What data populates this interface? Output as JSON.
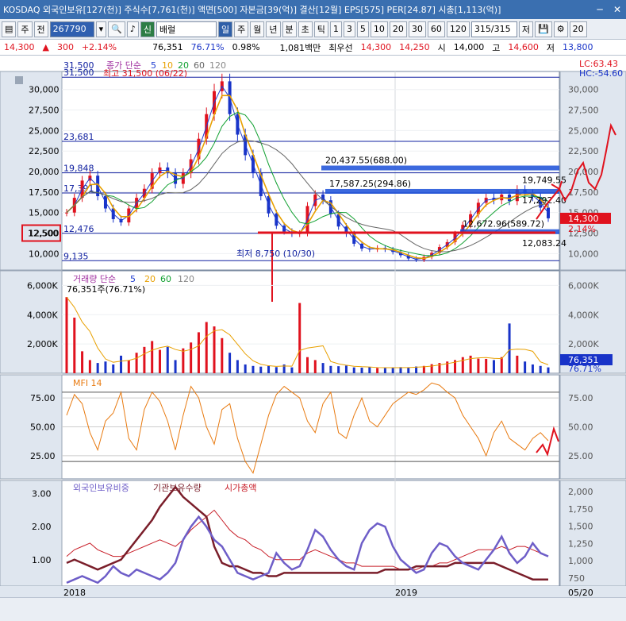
{
  "window": {
    "title": "KOSDAQ 외국인보유[127(천)] 주식수[7,761(천)] 액면[500] 자본금[39(억)] 결산[12월] EPS[575] PER[24.87] 시총[1,113(억)]",
    "minimize": "─",
    "close": "✕"
  },
  "toolbar": {
    "first_btn": "주",
    "second_btn": "전",
    "code": "267790",
    "name_tag": "신",
    "name": "배럴",
    "periods": [
      "일",
      "주",
      "월",
      "년",
      "분",
      "초",
      "틱"
    ],
    "intervals": [
      "1",
      "3",
      "5",
      "10",
      "20",
      "30",
      "60",
      "120"
    ],
    "count": "315/315",
    "buttons": [
      "저",
      "💾",
      "⚙"
    ],
    "extra": "20"
  },
  "quote": {
    "price": "14,300",
    "change_sign": "▲",
    "change": "300",
    "pct": "+2.14%",
    "volume": "76,351",
    "vol_ratio": "76.71%",
    "vol_pct": "0.98%",
    "amount": "1,081백만",
    "label_first": "최우선",
    "ask": "14,300",
    "bid": "14,250",
    "open_label": "시",
    "open": "14,000",
    "high_label": "고",
    "high": "14,600",
    "low_label": "저",
    "low": "13,800"
  },
  "price_panel": {
    "legend": {
      "name": "종가 단순",
      "p1": "5",
      "p2": "10",
      "p3": "20",
      "p4": "60",
      "p5": "120"
    },
    "lc": "LC:63.43",
    "hc": "HC:-54.60",
    "y_ticks": [
      "30,000",
      "27,500",
      "25,000",
      "22,500",
      "20,000",
      "17,500",
      "15,000",
      "12,500",
      "10,000"
    ],
    "y_values": [
      30000,
      27500,
      25000,
      22500,
      20000,
      17500,
      15000,
      12500,
      10000
    ],
    "hlines": [
      {
        "label": "31,500",
        "v": 31500
      },
      {
        "label": "23,681",
        "v": 23681
      },
      {
        "label": "19,848",
        "v": 19848
      },
      {
        "label": "17,391",
        "v": 17391
      },
      {
        "label": "12,476",
        "v": 12476
      },
      {
        "label": "9,135",
        "v": 9135
      }
    ],
    "top_label": "31,500",
    "max_note": "최고 31,500 (06/22)",
    "min_note": "최저 8,750 (10/30)",
    "boxes": [
      {
        "label": "20,437.55(688.00)",
        "v": 20437
      },
      {
        "label": "17,587.25(294.86)",
        "v": 17587
      },
      {
        "label": "12,672.96(589.72)",
        "v": 12673
      }
    ],
    "right_labels": [
      {
        "label": "19,749.55",
        "v": 19749
      },
      {
        "label": "17,292.40",
        "v": 17292
      },
      {
        "label": "12,083.24",
        "v": 12083
      }
    ],
    "current": "14,300",
    "current_pct": "2.14%",
    "left_marker": "12,500"
  },
  "volume_panel": {
    "legend": {
      "name": "거래량 단순",
      "p1": "5",
      "p2": "20",
      "p3": "60",
      "p4": "120"
    },
    "current": "76,351주(76.71%)",
    "y_ticks": [
      "6,000K",
      "4,000K",
      "2,000K"
    ],
    "right_val": "76,351",
    "right_pct": "76.71%"
  },
  "mfi_panel": {
    "legend": "MFI 14",
    "y_ticks": [
      "75.00",
      "50.00",
      "25.00"
    ]
  },
  "foreign_panel": {
    "legend": {
      "s1": "외국인보유비중",
      "s2": "기관보유수량",
      "s3": "시가총액"
    },
    "y_left": [
      "3.00",
      "2.00",
      "1.00"
    ],
    "y_right": [
      "2,000",
      "1,750",
      "1,500",
      "1,250",
      "1,000",
      "750"
    ]
  },
  "x_axis": {
    "labels": [
      "2018",
      "2019",
      "05/20"
    ]
  },
  "chart_data": {
    "type": "line",
    "title": "",
    "x": [
      "2018",
      "2019",
      "05/20"
    ],
    "price_close": [
      15000,
      16800,
      18900,
      19500,
      17000,
      15500,
      14200,
      13800,
      15500,
      16800,
      17900,
      19800,
      20500,
      19800,
      18500,
      19800,
      21500,
      24000,
      27000,
      29800,
      31000,
      27000,
      24500,
      22000,
      19800,
      17000,
      14900,
      13400,
      12700,
      12400,
      12476,
      15800,
      17200,
      16500,
      14800,
      13300,
      12400,
      11200,
      10600,
      10500,
      10700,
      10500,
      10200,
      9800,
      9400,
      9250,
      9600,
      10100,
      10800,
      11400,
      12400,
      13500,
      14800,
      16200,
      16800,
      16500,
      17200,
      16400,
      17800,
      17300,
      16900,
      15600,
      14300
    ],
    "ma_overlay": [
      "5",
      "10",
      "20",
      "60",
      "120"
    ],
    "volume_k_approx": [
      5200,
      3800,
      1500,
      900,
      700,
      800,
      600,
      1200,
      900,
      1400,
      1800,
      2200,
      1600,
      1800,
      900,
      1700,
      2100,
      2800,
      3500,
      3200,
      2400,
      1400,
      900,
      600,
      500,
      450,
      500,
      420,
      600,
      400,
      4800,
      1100,
      900,
      700,
      500,
      480,
      520,
      400,
      380,
      420,
      360,
      350,
      400,
      420,
      380,
      460,
      500,
      620,
      700,
      800,
      900,
      1100,
      1200,
      1000,
      980,
      900,
      1100,
      3400,
      1200,
      800,
      600,
      500,
      400
    ],
    "mfi": [
      60,
      78,
      70,
      45,
      30,
      55,
      62,
      80,
      40,
      30,
      65,
      80,
      72,
      55,
      30,
      60,
      85,
      75,
      50,
      35,
      65,
      70,
      40,
      20,
      10,
      35,
      60,
      78,
      85,
      80,
      75,
      55,
      45,
      70,
      80,
      45,
      40,
      60,
      75,
      55,
      50,
      60,
      70,
      75,
      80,
      78,
      82,
      88,
      86,
      80,
      75,
      60,
      50,
      40,
      25,
      45,
      55,
      40,
      35,
      30,
      40,
      45,
      38
    ],
    "foreign_pct": [
      0.3,
      0.4,
      0.5,
      0.4,
      0.3,
      0.5,
      0.8,
      0.6,
      0.5,
      0.7,
      0.6,
      0.5,
      0.4,
      0.6,
      0.9,
      1.6,
      2.0,
      2.3,
      2.0,
      1.6,
      1.4,
      1.0,
      0.6,
      0.5,
      0.4,
      0.5,
      0.6,
      1.2,
      0.9,
      0.7,
      0.8,
      1.3,
      1.9,
      1.7,
      1.3,
      1.0,
      0.8,
      0.7,
      1.5,
      1.9,
      2.1,
      2.0,
      1.4,
      1.0,
      0.8,
      0.6,
      0.7,
      1.2,
      1.5,
      1.4,
      1.1,
      0.9,
      0.8,
      0.7,
      1.0,
      1.3,
      1.7,
      1.2,
      0.9,
      1.1,
      1.5,
      1.2,
      1.1
    ],
    "institution_pct": [
      0.9,
      1.0,
      0.9,
      0.8,
      0.7,
      0.8,
      0.9,
      1.0,
      1.3,
      1.6,
      1.9,
      2.2,
      2.6,
      2.9,
      3.2,
      2.9,
      2.7,
      2.5,
      2.3,
      1.4,
      0.9,
      0.8,
      0.8,
      0.7,
      0.6,
      0.6,
      0.5,
      0.5,
      0.6,
      0.6,
      0.6,
      0.6,
      0.6,
      0.6,
      0.6,
      0.6,
      0.6,
      0.6,
      0.6,
      0.6,
      0.6,
      0.7,
      0.7,
      0.7,
      0.7,
      0.8,
      0.8,
      0.8,
      0.8,
      0.8,
      0.9,
      0.9,
      0.9,
      0.9,
      0.9,
      0.9,
      0.8,
      0.7,
      0.6,
      0.5,
      0.4,
      0.4,
      0.4
    ],
    "market_cap_pct": [
      1.1,
      1.3,
      1.4,
      1.5,
      1.3,
      1.2,
      1.1,
      1.1,
      1.2,
      1.3,
      1.4,
      1.5,
      1.6,
      1.5,
      1.4,
      1.6,
      1.9,
      2.1,
      2.3,
      2.5,
      2.2,
      1.9,
      1.7,
      1.6,
      1.4,
      1.3,
      1.1,
      1.0,
      1.0,
      1.0,
      1.0,
      1.2,
      1.3,
      1.2,
      1.1,
      1.0,
      0.9,
      0.9,
      0.8,
      0.8,
      0.8,
      0.8,
      0.8,
      0.7,
      0.7,
      0.7,
      0.8,
      0.8,
      0.9,
      0.9,
      1.0,
      1.1,
      1.2,
      1.3,
      1.3,
      1.3,
      1.4,
      1.3,
      1.4,
      1.4,
      1.3,
      1.2,
      1.1
    ]
  },
  "colors": {
    "up": "#e0121e",
    "down": "#1833c8",
    "ma5": "#1e3cd0",
    "ma10": "#e8a000",
    "ma20": "#10a030",
    "ma60": "#666666",
    "mfi": "#e87a10",
    "foreign": "#6e5ec8",
    "inst": "#7a1e2a",
    "cap": "#c81e28",
    "panel": "#ffffff",
    "axis": "#dfe6ef"
  }
}
